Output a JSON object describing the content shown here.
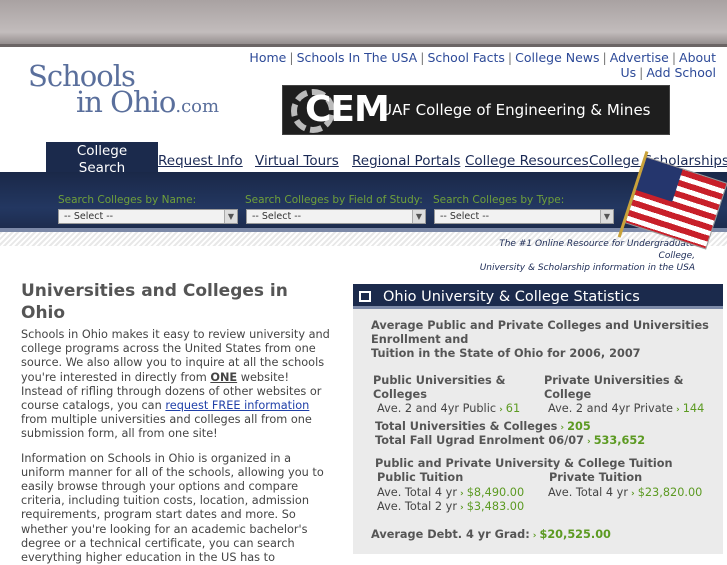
{
  "header": {
    "logo": {
      "line1": "Schools",
      "line2": "in Ohio",
      "suffix": ".com"
    },
    "links": [
      "Home",
      "Schools In The USA",
      "School Facts",
      "College News",
      "Advertise",
      "About Us",
      "Add School"
    ],
    "banner": {
      "brand": "CEM",
      "text": "UAF College of Engineering & Mines"
    }
  },
  "nav": {
    "active_tab": {
      "line1": "College",
      "line2": "Search"
    },
    "tabs": [
      "Request Info",
      "Virtual Tours",
      "Regional Portals",
      "College Resources",
      "College Scholarships"
    ]
  },
  "search": {
    "by_name_label": "Search Colleges by Name:",
    "by_field_label": "Search Colleges by Field of Study:",
    "by_type_label": "Search Colleges by Type:",
    "select_value": "-- Select --",
    "tagline_line1": "The #1 Online Resource for Undergraduate College,",
    "tagline_line2": "University & Scholarship information in the USA"
  },
  "main": {
    "title": "Universities and Colleges in Ohio",
    "p1_a": "Schools in Ohio makes it easy to review university and college programs across the United States from one source.  We also allow you to inquire at all the schools you're interested in directly from ",
    "p1_one": "ONE",
    "p1_b": " website! Instead of rifling through dozens of other websites or course catalogs, you can ",
    "p1_link": "request FREE information",
    "p1_c": "  from multiple universities and colleges all from one submission form, all from one site!",
    "p2": "Information on Schools in Ohio is organized in a uniform manner for all of the schools, allowing you to easily browse through your options and compare criteria, including tuition costs, location, admission requirements, program start dates and more. So whether you're looking for an academic bachelor's degree or a technical certificate, you can search everything higher education in the US has to"
  },
  "stats": {
    "header": "Ohio University & College Statistics",
    "intro_line1": "Average Public and Private Colleges and Universities",
    "intro_line2": "Enrollment and",
    "intro_line3": "Tuition in the State of Ohio for 2006, 2007",
    "public_label_1": "Public Universities &",
    "public_label_2": "Colleges",
    "public_sub": "Ave. 2 and 4yr Public",
    "public_val": "61",
    "private_label_1": "Private Universities &",
    "private_label_2": "College",
    "private_sub": "Ave. 2 and 4yr Private",
    "private_val": "144",
    "total_label": "Total Universities & Colleges",
    "total_val": "205",
    "enrol_label": "Total Fall Ugrad Enrolment 06/07",
    "enrol_val": "533,652",
    "tuition_head": "Public and Private University & College Tuition",
    "pub_tuition": "Public Tuition",
    "priv_tuition": "Private Tuition",
    "pub4_label": "Ave. Total 4 yr",
    "pub4_val": "$8,490.00",
    "pub2_label": "Ave. Total 2 yr",
    "pub2_val": "$3,483.00",
    "priv4_label": "Ave. Total 4 yr",
    "priv4_val": "$23,820.00",
    "debt_label": "Average Debt. 4 yr Grad:",
    "debt_val": "$20,525.00"
  },
  "colors": {
    "navy": "#1b2a4c",
    "link": "#2d4a98",
    "green": "#5c9a22"
  }
}
